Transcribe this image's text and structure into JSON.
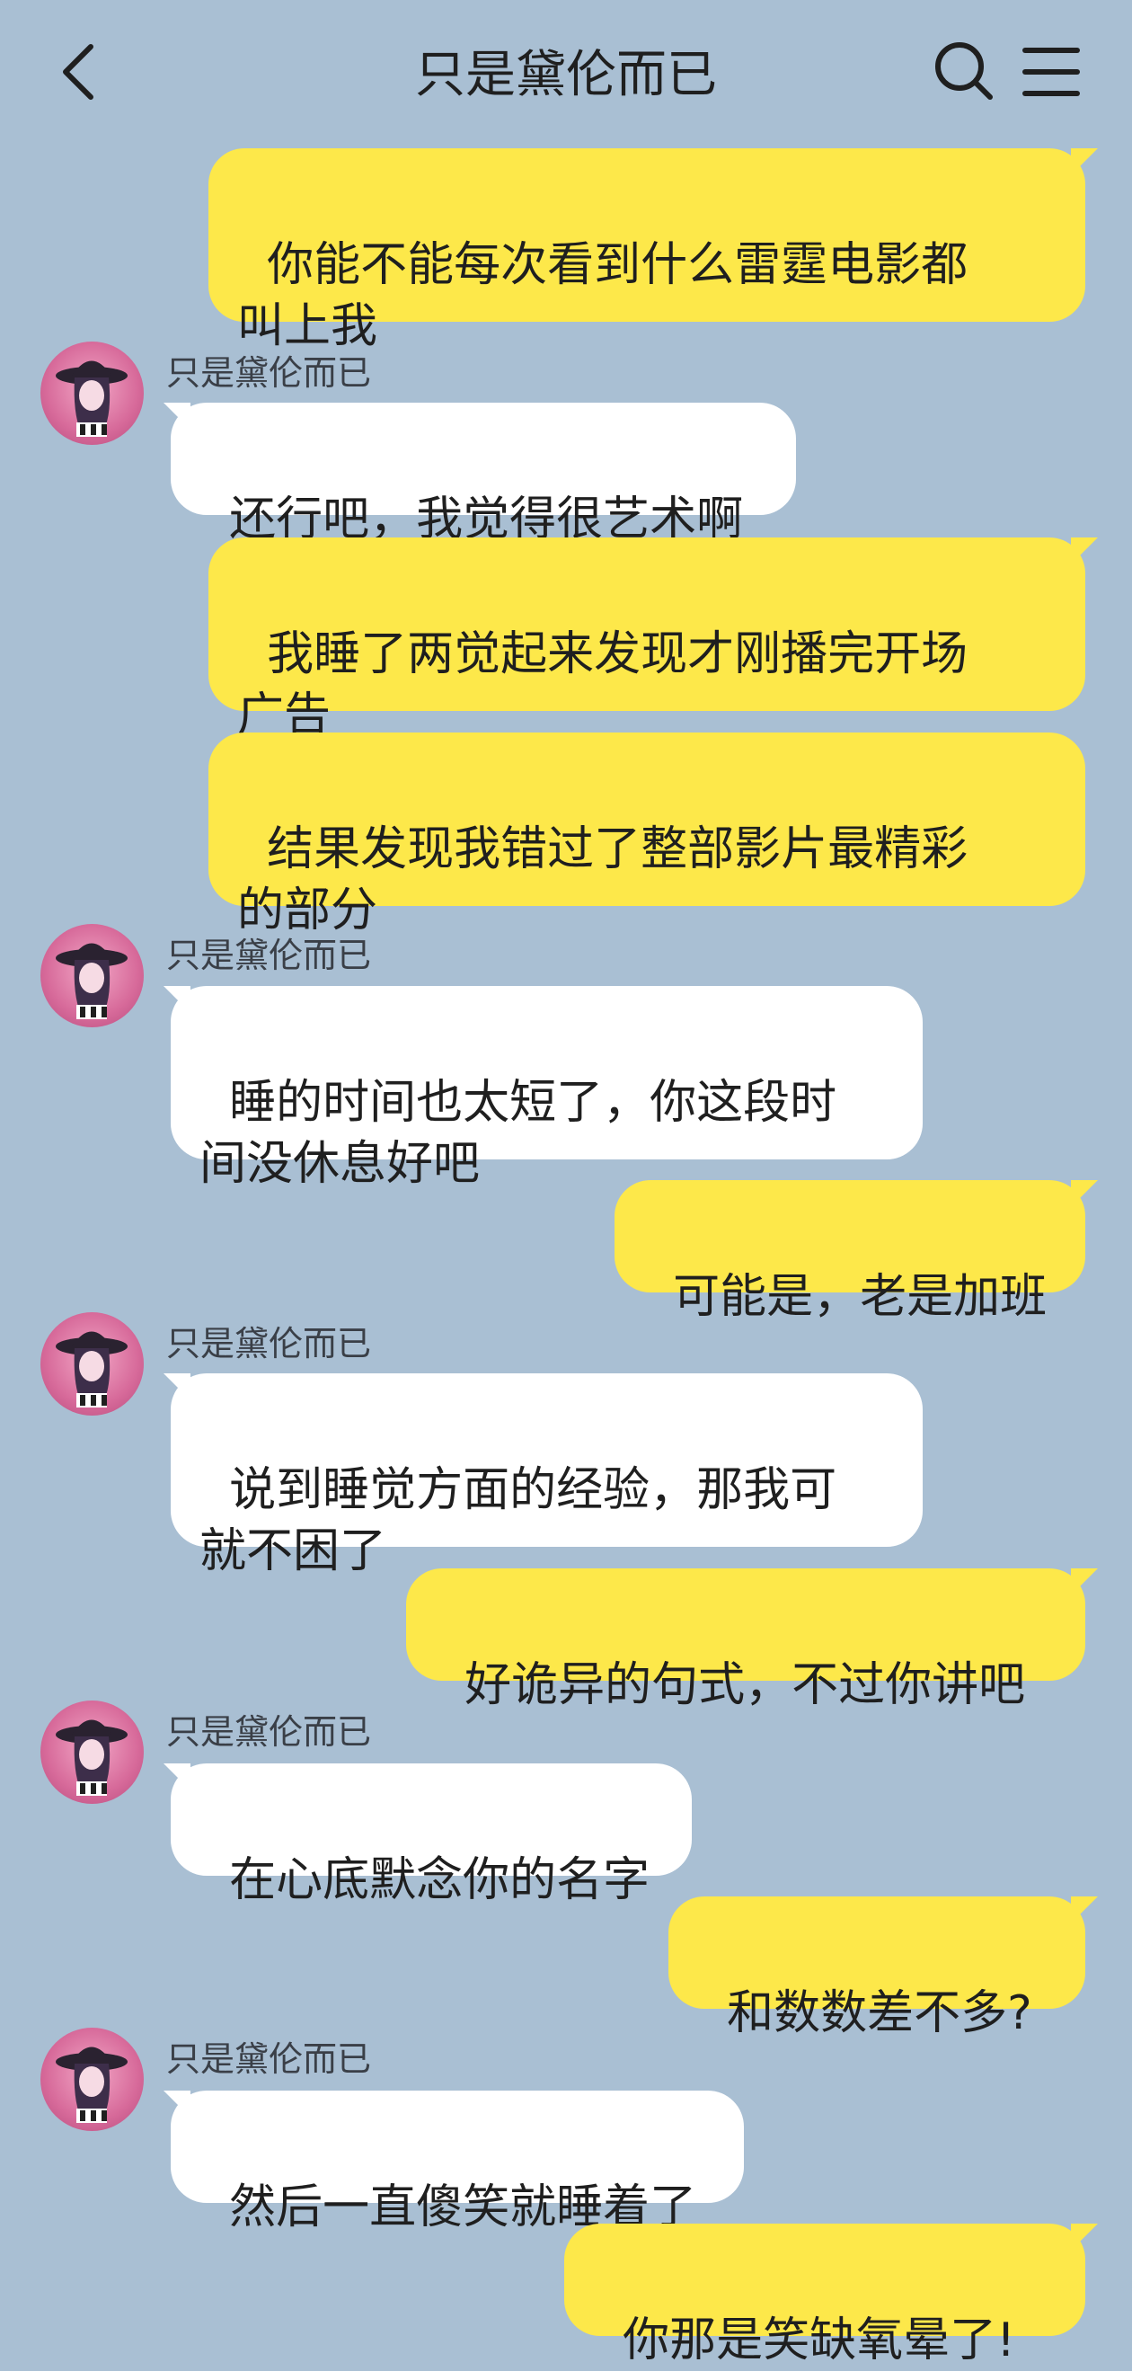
{
  "header": {
    "title": "只是黛伦而已"
  },
  "contact": {
    "name": "只是黛伦而已"
  },
  "colors": {
    "background": "#a9bfd3",
    "outgoing_bubble": "#fde84a",
    "incoming_bubble": "#ffffff"
  },
  "icons": {
    "back": "chevron-left-icon",
    "search": "search-icon",
    "menu": "menu-icon"
  },
  "messages": [
    {
      "from": "me",
      "text": "你能不能每次看到什么雷霆电影都\n叫上我"
    },
    {
      "from": "them",
      "sender": "只是黛伦而已",
      "text": "还行吧，我觉得很艺术啊"
    },
    {
      "from": "me",
      "text": "我睡了两觉起来发现才刚播完开场\n广告"
    },
    {
      "from": "me",
      "text": "结果发现我错过了整部影片最精彩\n的部分"
    },
    {
      "from": "them",
      "sender": "只是黛伦而已",
      "text": "睡的时间也太短了，你这段时\n间没休息好吧"
    },
    {
      "from": "me",
      "text": "可能是，老是加班"
    },
    {
      "from": "them",
      "sender": "只是黛伦而已",
      "text": "说到睡觉方面的经验，那我可\n就不困了"
    },
    {
      "from": "me",
      "text": "好诡异的句式，不过你讲吧"
    },
    {
      "from": "them",
      "sender": "只是黛伦而已",
      "text": "在心底默念你的名字"
    },
    {
      "from": "me",
      "text": "和数数差不多?"
    },
    {
      "from": "them",
      "sender": "只是黛伦而已",
      "text": "然后一直傻笑就睡着了"
    },
    {
      "from": "me",
      "text": "你那是笑缺氧晕了!"
    }
  ]
}
